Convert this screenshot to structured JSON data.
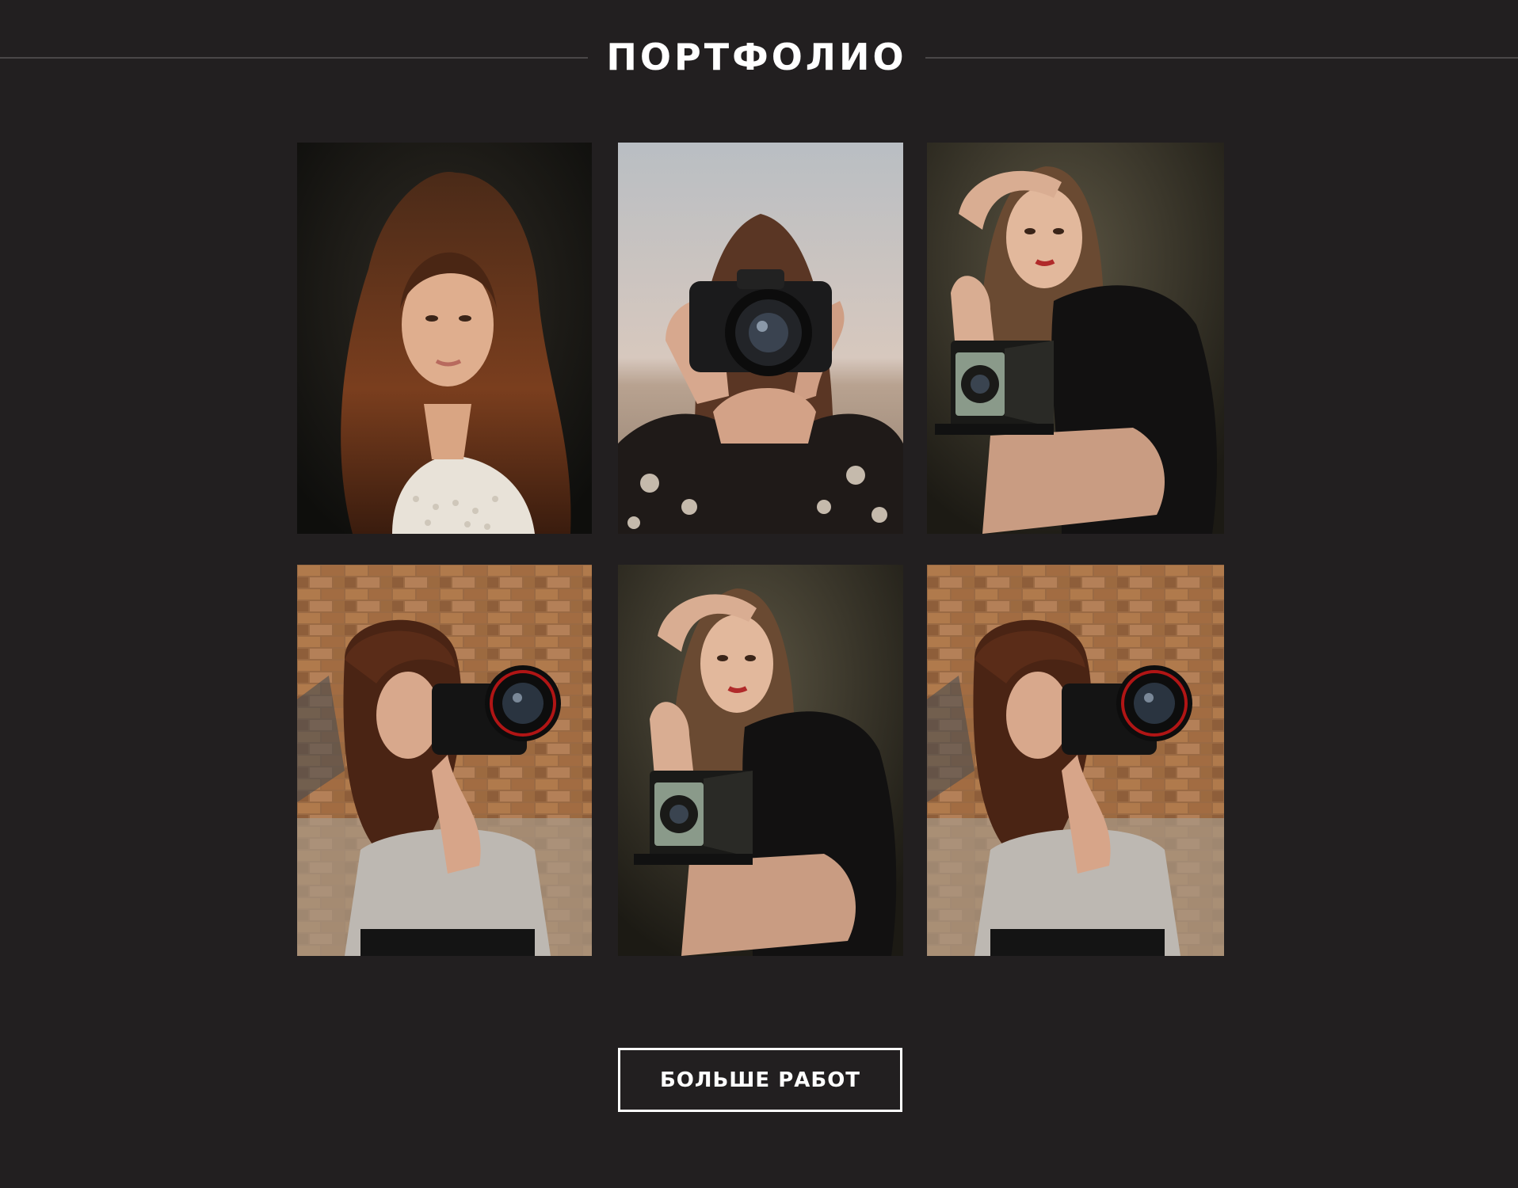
{
  "section": {
    "title": "ПОРТФОЛИО"
  },
  "gallery": {
    "photos": [
      {
        "subject": "portrait of woman with long wavy auburn hair, white lace top, dark background"
      },
      {
        "subject": "woman holding DSLR camera in front of face, cloudy sky, floral jacket"
      },
      {
        "subject": "woman with hand on head leaning on vintage folding camera, black dress, dark backdrop"
      },
      {
        "subject": "woman with bangs shooting with Canon camera, grey sweater, brick wall background"
      },
      {
        "subject": "woman with hand on head leaning on vintage folding camera, black dress, dark backdrop"
      },
      {
        "subject": "woman with bangs shooting with Canon camera, grey sweater, brick wall background"
      }
    ]
  },
  "actions": {
    "more_label": "БОЛЬШЕ РАБОТ"
  },
  "colors": {
    "background": "#221f20",
    "divider": "#4a4748",
    "text": "#ffffff"
  }
}
